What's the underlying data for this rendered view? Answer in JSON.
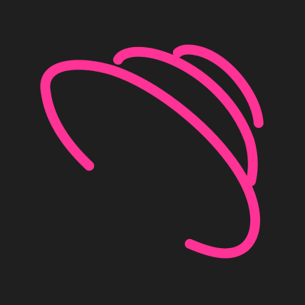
{
  "app_icon": {
    "icon": "pink-swirl-logo-icon",
    "colors": {
      "background": "#1f1f1f",
      "stroke": "#ff3296"
    }
  }
}
